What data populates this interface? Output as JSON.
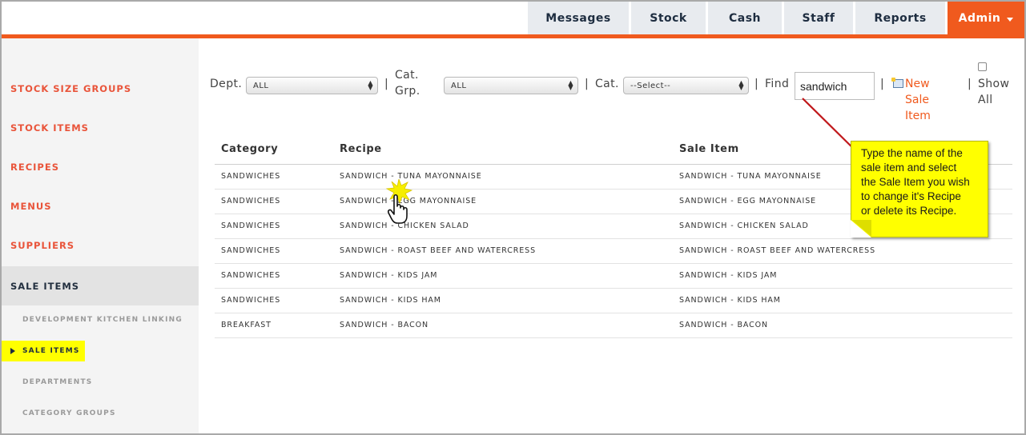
{
  "nav": {
    "tabs": [
      "Messages",
      "Stock",
      "Cash",
      "Staff",
      "Reports"
    ],
    "admin": "Admin"
  },
  "sidebar": {
    "items": [
      "STOCK SIZE GROUPS",
      "STOCK ITEMS",
      "RECIPES",
      "MENUS",
      "SUPPLIERS",
      "SALE ITEMS"
    ],
    "subitems": [
      "DEVELOPMENT KITCHEN LINKING",
      "SALE ITEMS",
      "DEPARTMENTS",
      "CATEGORY GROUPS"
    ]
  },
  "filters": {
    "dept_label": "Dept.",
    "dept_value": "ALL",
    "catgrp_label_1": "Cat.",
    "catgrp_label_2": "Grp.",
    "catgrp_value": "ALL",
    "cat_label": "Cat.",
    "cat_value": "--Select--",
    "find_label": "Find",
    "find_value": "sandwich",
    "sep": "|",
    "new_1": "New",
    "new_2": "Sale",
    "new_3": "Item",
    "show_1": "Show",
    "show_2": "All"
  },
  "table": {
    "headers": [
      "Category",
      "Recipe",
      "Sale Item"
    ],
    "rows": [
      [
        "SANDWICHES",
        "SANDWICH - TUNA MAYONNAISE",
        "SANDWICH - TUNA MAYONNAISE"
      ],
      [
        "SANDWICHES",
        "SANDWICH - EGG MAYONNAISE",
        "SANDWICH - EGG MAYONNAISE"
      ],
      [
        "SANDWICHES",
        "SANDWICH - CHICKEN SALAD",
        "SANDWICH - CHICKEN SALAD"
      ],
      [
        "SANDWICHES",
        "SANDWICH - ROAST BEEF AND WATERCRESS",
        "SANDWICH - ROAST BEEF AND WATERCRESS"
      ],
      [
        "SANDWICHES",
        "SANDWICH - KIDS JAM",
        "SANDWICH - KIDS JAM"
      ],
      [
        "SANDWICHES",
        "SANDWICH - KIDS HAM",
        "SANDWICH - KIDS HAM"
      ],
      [
        "BREAKFAST",
        "SANDWICH - BACON",
        "SANDWICH - BACON"
      ]
    ]
  },
  "callout": {
    "lines": [
      "Type the name of the",
      "sale item and select",
      "the Sale Item  you wish",
      "to change it's Recipe",
      "or delete its Recipe."
    ]
  },
  "colors": {
    "accent": "#f05a1e",
    "nav_text": "#1e2d40",
    "sidebar_link": "#e9543a",
    "highlight": "#ffff00",
    "callout_arrow": "#c0181b"
  },
  "icons": {
    "new_item": "new-item-icon",
    "cursor": "hand-pointer-icon",
    "caret": "caret-down-icon",
    "arrow": "sidebar-pointer-icon"
  }
}
